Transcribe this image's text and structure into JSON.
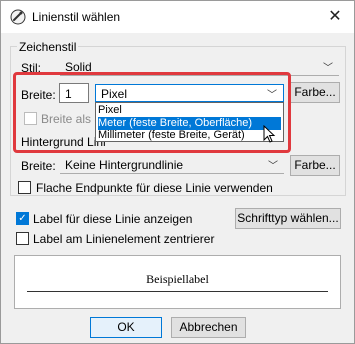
{
  "window": {
    "title": "Linienstil wählen",
    "close_glyph": "✕"
  },
  "drawing_group": {
    "title": "Zeichenstil",
    "style_label": "Stil:",
    "style_value": "Solid",
    "width_label": "Breite:",
    "width_value": "1",
    "unit_value": "Pixel",
    "color_button": "Farbe...",
    "width_3d_label": "Breite als 3D",
    "unit_options": [
      {
        "label": "Pixel",
        "selected": false
      },
      {
        "label": "Meter (feste Breite, Oberfläche)",
        "selected": true
      },
      {
        "label": "Millimeter (feste Breite, Gerät)",
        "selected": false
      }
    ]
  },
  "background_group": {
    "title": "Hintergrund Lini",
    "width_label": "Breite:",
    "width_value": "Keine Hintergrundlinie",
    "color_button": "Farbe...",
    "flat_endpoints_label": "Flache Endpunkte für diese Linie verwenden",
    "flat_endpoints_checked": false
  },
  "label_options": {
    "show_label": "Label für diese Linie anzeigen",
    "show_label_checked": true,
    "font_button": "Schrifttyp wählen...",
    "center_label": "Label am Linienelement zentrierer",
    "center_label_checked": false
  },
  "preview": {
    "text": "Beispiellabel"
  },
  "footer": {
    "ok": "OK",
    "cancel": "Abbrechen"
  },
  "colors": {
    "accent": "#0078d7",
    "highlight": "#e0393e"
  }
}
